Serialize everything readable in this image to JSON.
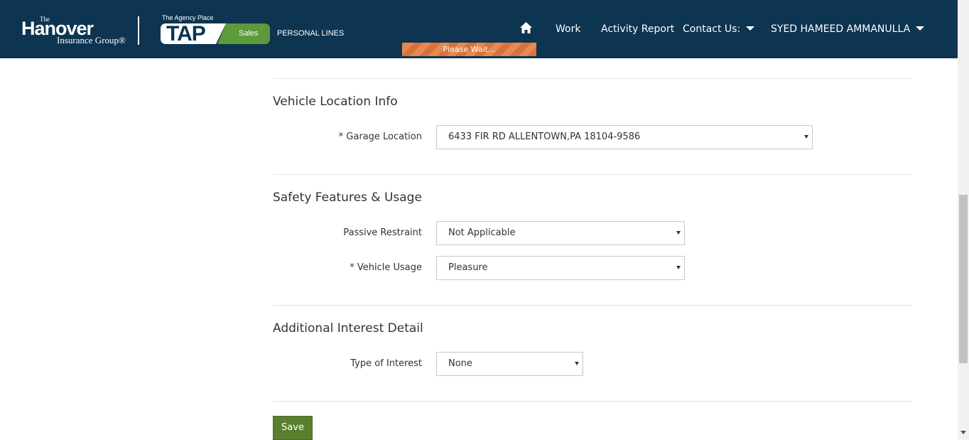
{
  "header": {
    "brand": {
      "the": "The",
      "name": "Hanover",
      "group": "Insurance Group®"
    },
    "tap": {
      "agency_place": "The Agency Place",
      "tap": "TAP",
      "sales": "Sales",
      "personal_lines": "PERSONAL LINES"
    },
    "nav": {
      "home_icon": "home-icon",
      "work": "Work",
      "activity_report": "Activity Report",
      "contact_us": "Contact Us:",
      "user": "SYED HAMEED AMMANULLA"
    },
    "please_wait": "Please Wait...",
    "colors": {
      "bg": "#0d3451",
      "sales": "#5c9a3a",
      "wait": "#d6733b"
    }
  },
  "sections": {
    "vehicle_location": {
      "title": "Vehicle Location Info",
      "garage_label": "* Garage Location",
      "garage_value": "6433 FIR RD ALLENTOWN,PA 18104-9586"
    },
    "safety": {
      "title": "Safety Features & Usage",
      "passive_label": "Passive Restraint",
      "passive_value": "Not Applicable",
      "usage_label": "* Vehicle Usage",
      "usage_value": "Pleasure"
    },
    "interest": {
      "title": "Additional Interest Detail",
      "type_label": "Type of Interest",
      "type_value": "None"
    }
  },
  "actions": {
    "save": "Save",
    "save_color": "#5a7f2f"
  }
}
